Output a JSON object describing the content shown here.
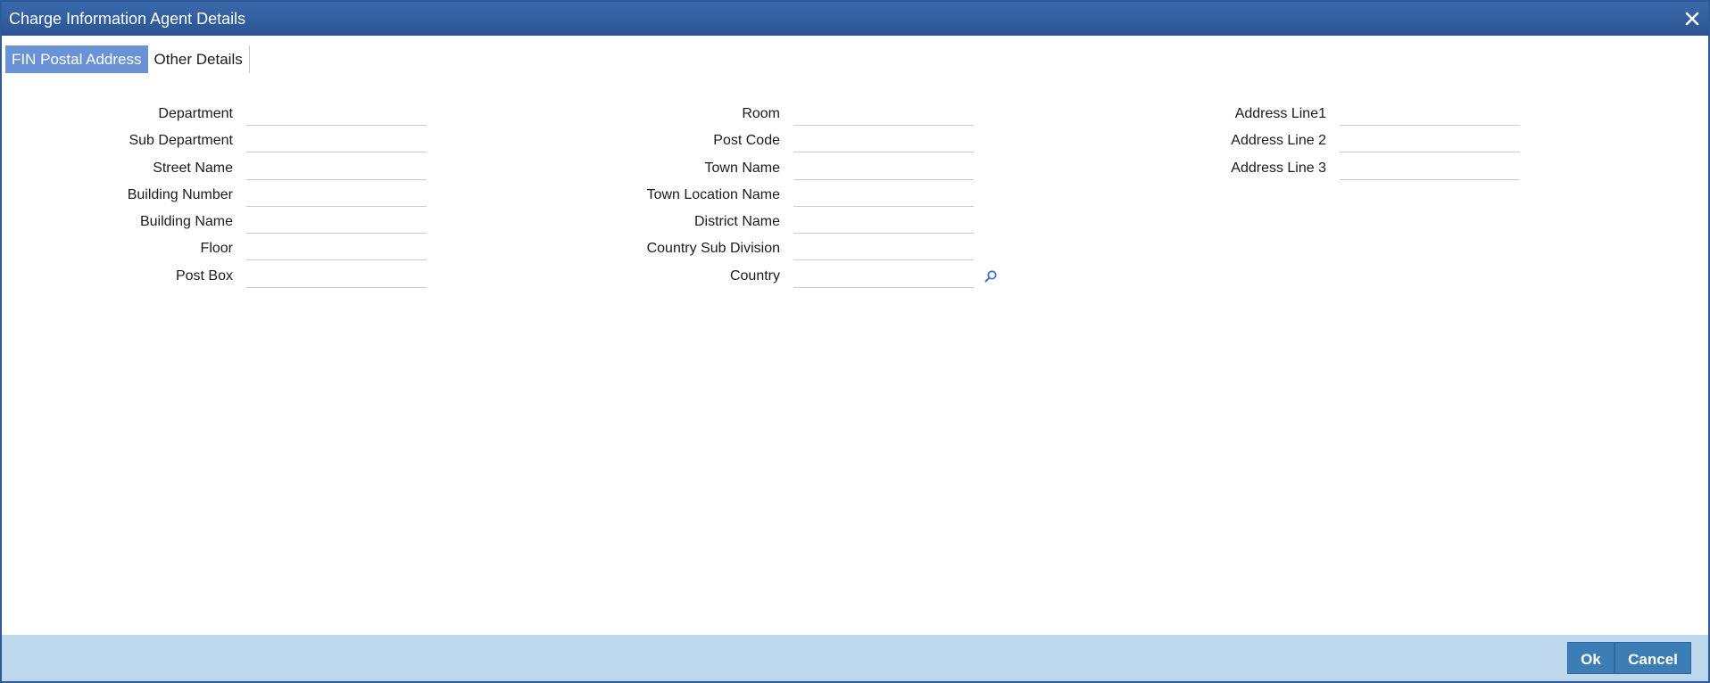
{
  "window": {
    "title": "Charge Information Agent Details"
  },
  "tabs": [
    {
      "label": "FIN Postal Address",
      "active": true
    },
    {
      "label": "Other Details",
      "active": false
    }
  ],
  "columns": [
    {
      "fields": [
        {
          "label": "Department",
          "value": ""
        },
        {
          "label": "Sub Department",
          "value": ""
        },
        {
          "label": "Street Name",
          "value": ""
        },
        {
          "label": "Building Number",
          "value": ""
        },
        {
          "label": "Building Name",
          "value": ""
        },
        {
          "label": "Floor",
          "value": ""
        },
        {
          "label": "Post Box",
          "value": ""
        }
      ]
    },
    {
      "fields": [
        {
          "label": "Room",
          "value": ""
        },
        {
          "label": "Post Code",
          "value": ""
        },
        {
          "label": "Town Name",
          "value": ""
        },
        {
          "label": "Town Location Name",
          "value": ""
        },
        {
          "label": "District Name",
          "value": ""
        },
        {
          "label": "Country Sub Division",
          "value": ""
        },
        {
          "label": "Country",
          "value": "",
          "lookup_icon": "search-icon"
        }
      ]
    },
    {
      "fields": [
        {
          "label": "Address Line1",
          "value": ""
        },
        {
          "label": "Address Line 2",
          "value": ""
        },
        {
          "label": "Address Line 3",
          "value": ""
        }
      ]
    }
  ],
  "footer": {
    "ok_label": "Ok",
    "cancel_label": "Cancel"
  },
  "colors": {
    "titlebar": "#2d5b99",
    "active_tab": "#6993d4",
    "footer": "#bdd7ec",
    "button": "#3d7db5"
  }
}
